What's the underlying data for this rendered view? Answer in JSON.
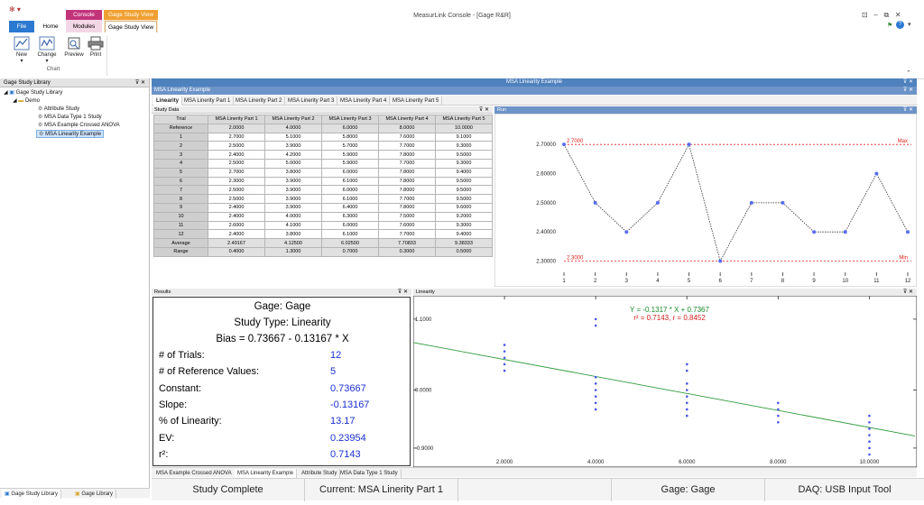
{
  "window": {
    "title": "MeasurLink Console - [Gage R&R]"
  },
  "ribbon": {
    "context_console": "Console",
    "context_gage": "Gage Study View",
    "tabs": [
      "File",
      "Home",
      "Modules",
      "Gage Study View"
    ],
    "buttons": [
      "New",
      "Change",
      "Preview",
      "Print"
    ],
    "group_label": "Chart"
  },
  "library": {
    "header": "Gage Study Library",
    "root": "Gage Study Library",
    "folder": "Demo",
    "items": [
      "Attribute Study",
      "MSA Data Type 1 Study",
      "MSA Example Crossed ANOVA",
      "MSA Linearity Example"
    ],
    "bottom_tabs": [
      "Gage Study Library",
      "Gage Library"
    ]
  },
  "main": {
    "header": "MSA Linearity Example",
    "doc_title": "MSA Linearity Example",
    "tabs": [
      "Linearity",
      "MSA Linerity Part 1",
      "MSA Linerity Part 2",
      "MSA Linerity Part 3",
      "MSA Linerity Part 4",
      "MSA Linerity Part 5"
    ],
    "bottom_tabs": [
      "MSA Example Crossed ANOVA",
      "MSA Linearity Example",
      "Attribute Study",
      "MSA Data Type 1 Study"
    ]
  },
  "study_data": {
    "header": "Study Data",
    "columns": [
      "Trial",
      "MSA Linerity Part 1",
      "MSA Linerity Part 2",
      "MSA Linerity Part 3",
      "MSA Linerity Part 4",
      "MSA Linerity Part 5"
    ],
    "rows": [
      [
        "Reference",
        "2.0000",
        "4.0000",
        "6.0000",
        "8.0000",
        "10.0000"
      ],
      [
        "1",
        "2.7000",
        "5.1000",
        "5.8000",
        "7.6000",
        "9.1000"
      ],
      [
        "2",
        "2.5000",
        "3.9000",
        "5.7000",
        "7.7000",
        "9.3000"
      ],
      [
        "3",
        "2.4000",
        "4.2000",
        "5.9000",
        "7.8000",
        "9.5000"
      ],
      [
        "4",
        "2.5000",
        "5.0000",
        "5.9000",
        "7.7000",
        "9.3000"
      ],
      [
        "5",
        "2.7000",
        "3.8000",
        "6.0000",
        "7.8000",
        "9.4000"
      ],
      [
        "6",
        "2.3000",
        "3.9000",
        "6.1000",
        "7.8000",
        "9.5000"
      ],
      [
        "7",
        "2.5000",
        "3.9000",
        "6.0000",
        "7.8000",
        "9.5000"
      ],
      [
        "8",
        "2.5000",
        "3.9000",
        "6.1000",
        "7.7000",
        "9.5000"
      ],
      [
        "9",
        "2.4000",
        "3.9000",
        "6.4000",
        "7.8000",
        "9.6000"
      ],
      [
        "10",
        "2.4000",
        "4.0000",
        "6.3000",
        "7.5000",
        "9.2000"
      ],
      [
        "11",
        "2.6000",
        "4.1000",
        "6.0000",
        "7.6000",
        "9.3000"
      ],
      [
        "12",
        "2.4000",
        "3.8000",
        "6.1000",
        "7.7000",
        "9.4000"
      ],
      [
        "Average",
        "2.49167",
        "4.12500",
        "6.02500",
        "7.70833",
        "9.38333"
      ],
      [
        "Range",
        "0.4000",
        "1.3000",
        "0.7000",
        "0.3000",
        "0.5000"
      ]
    ]
  },
  "run": {
    "header": "Run",
    "max_label": "Max",
    "min_label": "Min",
    "max_value_label": "2.7000",
    "min_value_label": "2.3000"
  },
  "results": {
    "header": "Results",
    "gage": "Gage: Gage",
    "study_type": "Study Type: Linearity",
    "bias": "Bias = 0.73667 - 0.13167 * X",
    "rows": [
      {
        "label": "# of Trials:",
        "value": "12"
      },
      {
        "label": "# of Reference Values:",
        "value": "5"
      },
      {
        "label": "Constant:",
        "value": "0.73667"
      },
      {
        "label": "Slope:",
        "value": "-0.13167"
      },
      {
        "label": "% of Linearity:",
        "value": "13.17"
      },
      {
        "label": "EV:",
        "value": "0.23954"
      },
      {
        "label": "r²:",
        "value": "0.7143"
      }
    ]
  },
  "linearity": {
    "header": "Linearity",
    "equation": "Y = -0.1317 * X + 0.7367",
    "stats": "r² = 0.7143,   r = 0.8452"
  },
  "status": [
    "Study Complete",
    "Current: MSA Linerity Part 1",
    "Gage: Gage",
    "DAQ: USB Input Tool"
  ],
  "colors": {
    "accent": "#4f81bd",
    "value_blue": "#1b2fd0",
    "limit_red": "#e02020",
    "fit_green": "#2e9a3a"
  },
  "chart_data": [
    {
      "type": "line",
      "title": "",
      "x": [
        1,
        2,
        3,
        4,
        5,
        6,
        7,
        8,
        9,
        10,
        11,
        12
      ],
      "series": [
        {
          "values": [
            2.7,
            2.5,
            2.4,
            2.5,
            2.7,
            2.3,
            2.5,
            2.5,
            2.4,
            2.4,
            2.6,
            2.4
          ]
        }
      ],
      "ylim": [
        2.28,
        2.75
      ],
      "yticks": [
        "2.70000",
        "2.60000",
        "2.50000",
        "2.40000",
        "2.30000"
      ],
      "ytick_values": [
        2.7,
        2.6,
        2.5,
        2.4,
        2.3
      ],
      "limits": {
        "max": 2.7,
        "min": 2.3
      }
    },
    {
      "type": "scatter",
      "title": "",
      "x_ticks": [
        "2.0000",
        "4.0000",
        "6.0000",
        "8.0000",
        "10.0000"
      ],
      "x_tick_values": [
        2,
        4,
        6,
        8,
        10
      ],
      "y_ticks": [
        "1.1000",
        "0.0000",
        "-0.9000"
      ],
      "y_tick_values": [
        1.1,
        0.0,
        -0.9
      ],
      "xlim": [
        0.0,
        11.0
      ],
      "ylim": [
        -1.0,
        1.35
      ],
      "points": [
        [
          2,
          0.7
        ],
        [
          2,
          0.5
        ],
        [
          2,
          0.4
        ],
        [
          2,
          0.3
        ],
        [
          2,
          0.6
        ],
        [
          4,
          1.1
        ],
        [
          4,
          1.0
        ],
        [
          4,
          -0.1
        ],
        [
          4,
          -0.2
        ],
        [
          4,
          -0.3
        ],
        [
          4,
          0.0
        ],
        [
          4,
          0.2
        ],
        [
          4,
          0.1
        ],
        [
          6,
          -0.2
        ],
        [
          6,
          -0.3
        ],
        [
          6,
          -0.1
        ],
        [
          6,
          0.0
        ],
        [
          6,
          0.1
        ],
        [
          6,
          0.3
        ],
        [
          6,
          0.4
        ],
        [
          6,
          -0.4
        ],
        [
          8,
          -0.4
        ],
        [
          8,
          -0.3
        ],
        [
          8,
          -0.2
        ],
        [
          8,
          -0.5
        ],
        [
          10,
          -0.9
        ],
        [
          10,
          -0.8
        ],
        [
          10,
          -0.7
        ],
        [
          10,
          -0.6
        ],
        [
          10,
          -0.5
        ],
        [
          10,
          -0.4
        ],
        [
          10,
          -1.0
        ]
      ],
      "fit": {
        "slope": -0.1317,
        "intercept": 0.7367
      }
    }
  ]
}
